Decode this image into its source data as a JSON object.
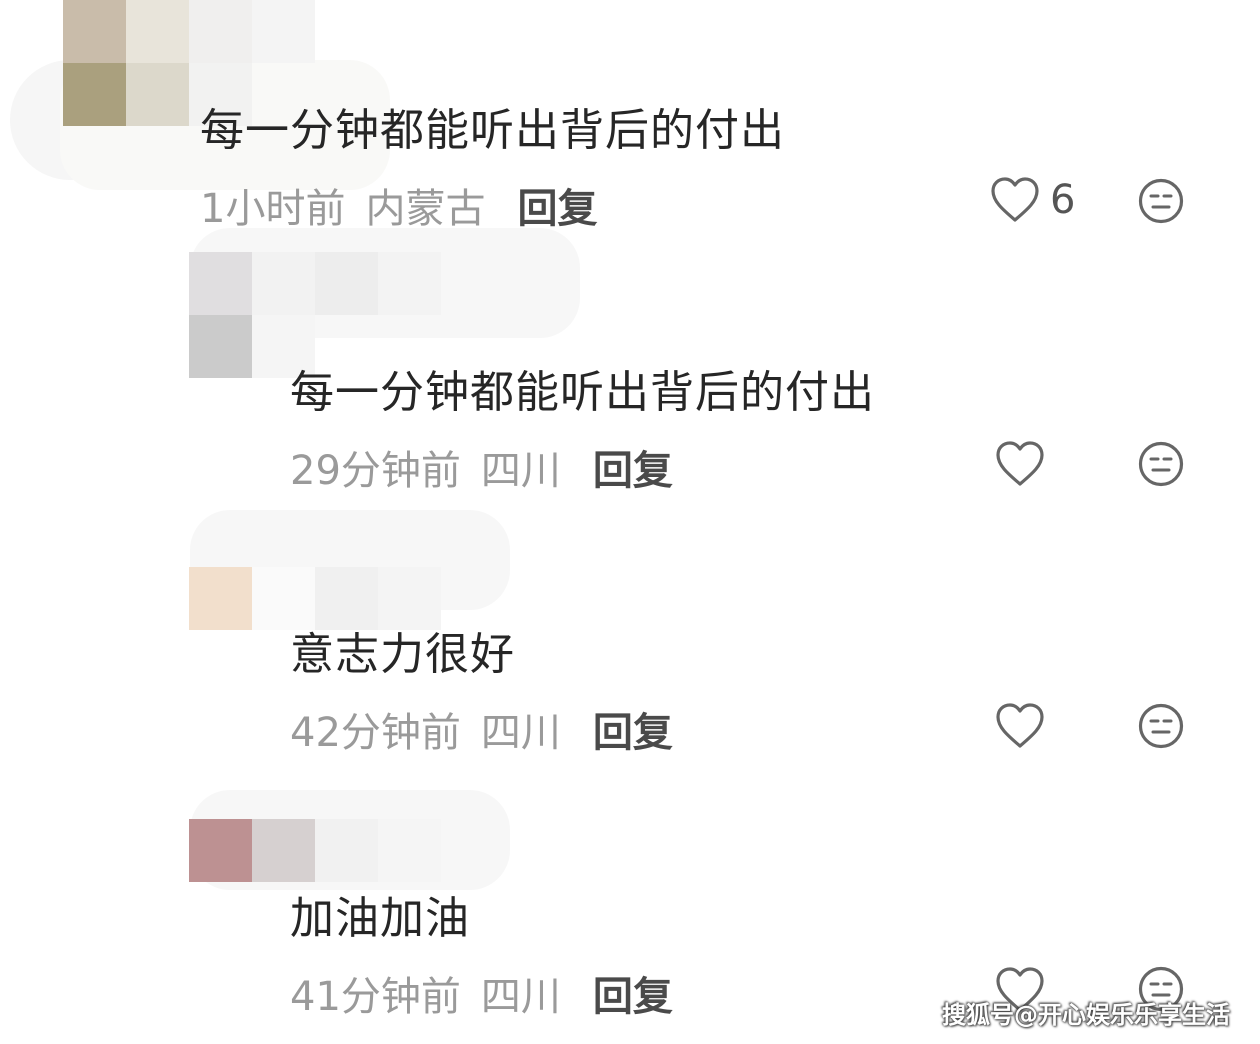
{
  "comments": [
    {
      "text": "每一分钟都能听出背后的付出",
      "time": "1小时前",
      "location": "内蒙古",
      "reply_label": "回复",
      "like_count": "6",
      "level": "top"
    },
    {
      "text": "每一分钟都能听出背后的付出",
      "time": "29分钟前",
      "location": "四川",
      "reply_label": "回复",
      "like_count": "",
      "level": "reply"
    },
    {
      "text": "意志力很好",
      "time": "42分钟前",
      "location": "四川",
      "reply_label": "回复",
      "like_count": "",
      "level": "reply"
    },
    {
      "text": "加油加油",
      "time": "41分钟前",
      "location": "四川",
      "reply_label": "回复",
      "like_count": "",
      "level": "reply"
    }
  ],
  "icons": {
    "like": "heart-outline-icon",
    "reaction": "neutral-face-icon"
  },
  "colors": {
    "text": "#262626",
    "meta": "#9a9a9a",
    "reply": "#4a4a4a",
    "icon": "#666666"
  },
  "watermark": "搜狐号@开心娱乐乐享生活"
}
